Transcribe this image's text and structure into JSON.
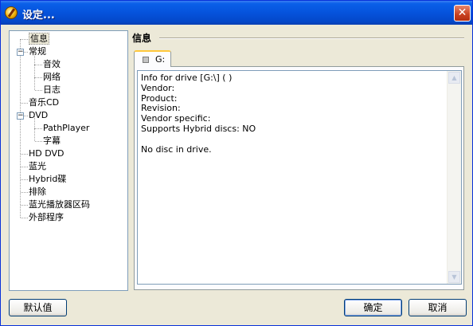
{
  "window": {
    "title": "设定...",
    "close_symbol": "✕",
    "icon": "app-disc-icon"
  },
  "tree": {
    "items": [
      {
        "label": "信息",
        "level": 0,
        "selected": true
      },
      {
        "label": "常规",
        "level": 0,
        "expander": "−"
      },
      {
        "label": "音效",
        "level": 1
      },
      {
        "label": "网络",
        "level": 1
      },
      {
        "label": "日志",
        "level": 1
      },
      {
        "label": "音乐CD",
        "level": 0
      },
      {
        "label": "DVD",
        "level": 0,
        "expander": "−"
      },
      {
        "label": "PathPlayer",
        "level": 1
      },
      {
        "label": "字幕",
        "level": 1
      },
      {
        "label": "HD DVD",
        "level": 0
      },
      {
        "label": "蓝光",
        "level": 0
      },
      {
        "label": "Hybrid碟",
        "level": 0
      },
      {
        "label": "排除",
        "level": 0
      },
      {
        "label": "蓝光播放器区码",
        "level": 0
      },
      {
        "label": "外部程序",
        "level": 0
      }
    ]
  },
  "section": {
    "title": "信息"
  },
  "tabs": [
    {
      "label": "G:",
      "active": true
    }
  ],
  "info_text": {
    "lines": [
      "Info for drive [G:\\] ( )",
      "Vendor:",
      "Product:",
      "Revision:",
      "Vendor specific:",
      "Supports Hybrid discs: NO",
      "",
      "No disc in drive."
    ]
  },
  "scrollbar": {
    "up_symbol": "▲",
    "down_symbol": "▼"
  },
  "buttons": {
    "defaults": "默认值",
    "ok": "确定",
    "cancel": "取消"
  }
}
